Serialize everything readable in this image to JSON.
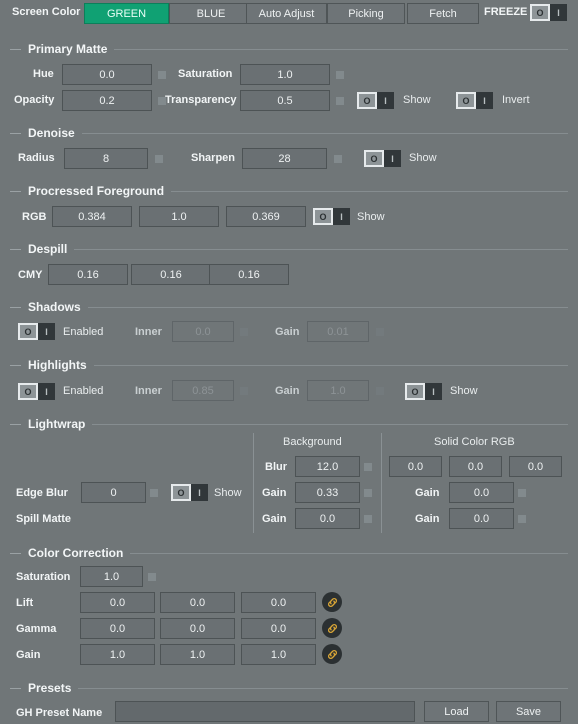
{
  "header": {
    "screen_color_label": "Screen Color",
    "green_label": "GREEN",
    "blue_label": "BLUE",
    "auto_adjust_label": "Auto Adjust",
    "picking_label": "Picking",
    "fetch_label": "Fetch",
    "freeze_label": "FREEZE",
    "freeze_toggle_off": "O",
    "freeze_toggle_on": "I",
    "active_color": "#10a173"
  },
  "toggle": {
    "off": "O",
    "on": "I"
  },
  "primary_matte": {
    "title": "Primary Matte",
    "hue_label": "Hue",
    "hue_value": "0.0",
    "saturation_label": "Saturation",
    "saturation_value": "1.0",
    "opacity_label": "Opacity",
    "opacity_value": "0.2",
    "transparency_label": "Transparency",
    "transparency_value": "0.5",
    "show_label": "Show",
    "invert_label": "Invert"
  },
  "denoise": {
    "title": "Denoise",
    "radius_label": "Radius",
    "radius_value": "8",
    "sharpen_label": "Sharpen",
    "sharpen_value": "28",
    "show_label": "Show"
  },
  "processed_foreground": {
    "title": "Procressed Foreground",
    "rgb_label": "RGB",
    "r_value": "0.384",
    "g_value": "1.0",
    "b_value": "0.369",
    "show_label": "Show"
  },
  "despill": {
    "title": "Despill",
    "cmy_label": "CMY",
    "c_value": "0.16",
    "m_value": "0.16",
    "y_value": "0.16"
  },
  "shadows": {
    "title": "Shadows",
    "enabled_label": "Enabled",
    "inner_label": "Inner",
    "inner_value": "0.0",
    "gain_label": "Gain",
    "gain_value": "0.01"
  },
  "highlights": {
    "title": "Highlights",
    "enabled_label": "Enabled",
    "inner_label": "Inner",
    "inner_value": "0.85",
    "gain_label": "Gain",
    "gain_value": "1.0",
    "show_label": "Show"
  },
  "lightwrap": {
    "title": "Lightwrap",
    "background_header": "Background",
    "solid_color_header": "Solid Color RGB",
    "edge_blur_label": "Edge Blur",
    "edge_blur_value": "0",
    "show_label": "Show",
    "spill_matte_label": "Spill Matte",
    "bg_blur_label": "Blur",
    "bg_blur_value": "12.0",
    "bg_gain1_label": "Gain",
    "bg_gain1_value": "0.33",
    "bg_gain2_label": "Gain",
    "bg_gain2_value": "0.0",
    "solid_r": "0.0",
    "solid_g": "0.0",
    "solid_b": "0.0",
    "solid_gain1_label": "Gain",
    "solid_gain1_value": "0.0",
    "solid_gain2_label": "Gain",
    "solid_gain2_value": "0.0"
  },
  "color_correction": {
    "title": "Color Correction",
    "saturation_label": "Saturation",
    "saturation_value": "1.0",
    "lift_label": "Lift",
    "lift_r": "0.0",
    "lift_g": "0.0",
    "lift_b": "0.0",
    "gamma_label": "Gamma",
    "gamma_r": "0.0",
    "gamma_g": "0.0",
    "gamma_b": "0.0",
    "gain_label": "Gain",
    "gain_r": "1.0",
    "gain_g": "1.0",
    "gain_b": "1.0",
    "link_icon_color": "#d9a636"
  },
  "presets": {
    "title": "Presets",
    "name_label": "GH Preset Name",
    "name_value": "",
    "name_placeholder": "",
    "load_label": "Load",
    "save_label": "Save"
  }
}
